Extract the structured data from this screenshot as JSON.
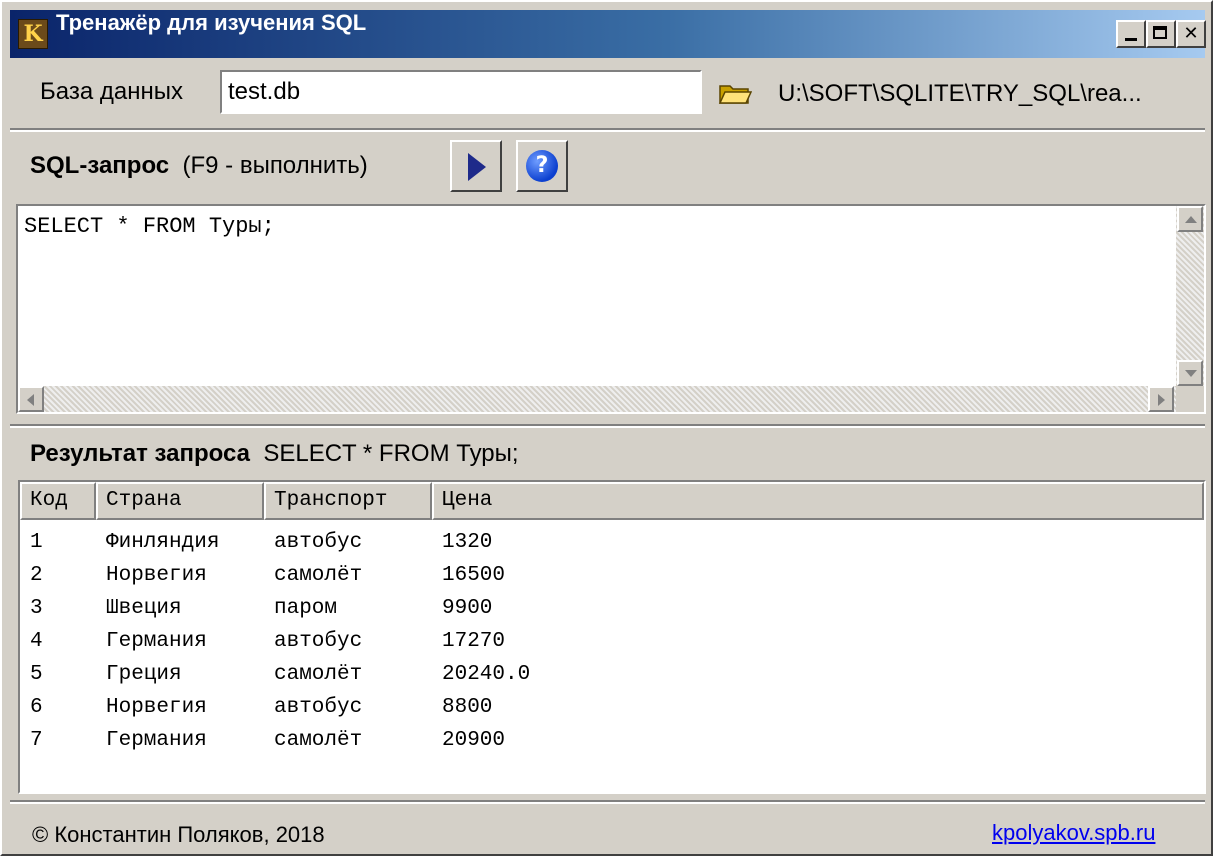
{
  "window": {
    "title": "Тренажёр для изучения SQL",
    "minimize": "_",
    "close": "✕"
  },
  "database": {
    "label": "База данных",
    "value": "test.db",
    "path": "U:\\SOFT\\SQLITE\\TRY_SQL\\rea..."
  },
  "query": {
    "label_bold": "SQL-запрос",
    "label_hint": "(F9 - выполнить)",
    "text": "SELECT * FROM Туры;",
    "help": "?"
  },
  "result": {
    "label_bold": "Результат запроса",
    "label_query": "SELECT * FROM Туры;",
    "columns": [
      "Код",
      "Страна",
      "Транспорт",
      "Цена"
    ],
    "rows": [
      [
        "1",
        "Финляндия",
        "автобус",
        "1320"
      ],
      [
        "2",
        "Норвегия",
        "самолёт",
        "16500"
      ],
      [
        "3",
        "Швеция",
        "паром",
        "9900"
      ],
      [
        "4",
        "Германия",
        "автобус",
        "17270"
      ],
      [
        "5",
        "Греция",
        "самолёт",
        "20240.0"
      ],
      [
        "6",
        "Норвегия",
        "автобус",
        "8800"
      ],
      [
        "7",
        "Германия",
        "самолёт",
        "20900"
      ]
    ]
  },
  "status": {
    "copyright": "© Константин Поляков, 2018",
    "link": "kpolyakov.spb.ru"
  },
  "colors": {
    "title_gradient_start": "#0a246a",
    "title_gradient_end": "#a6caf0",
    "face": "#d4d0c8",
    "link": "#0000ee"
  }
}
